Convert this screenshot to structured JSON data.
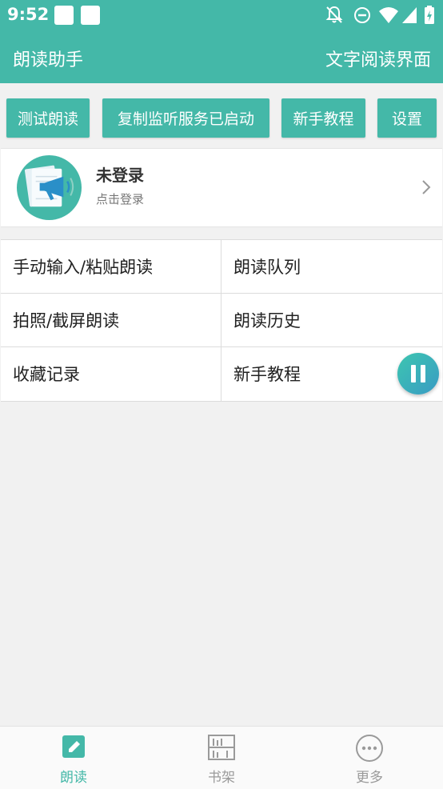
{
  "status_bar": {
    "time": "9:52",
    "icons": [
      "notification-square-icon",
      "notification-square-icon",
      "bell-off-icon",
      "do-not-disturb-icon",
      "wifi-icon",
      "signal-icon",
      "battery-charging-icon"
    ]
  },
  "app_bar": {
    "title": "朗读助手",
    "action": "文字阅读界面"
  },
  "buttons": {
    "test_read": "测试朗读",
    "copy_service": "复制监听服务已启动",
    "tutorial": "新手教程",
    "settings": "设置"
  },
  "login": {
    "name": "未登录",
    "hint": "点击登录",
    "avatar_icon": "megaphone-icon"
  },
  "menu": {
    "manual_input": "手动输入/粘贴朗读",
    "queue": "朗读队列",
    "photo": "拍照/截屏朗读",
    "history": "朗读历史",
    "favorites": "收藏记录",
    "tutorial": "新手教程"
  },
  "bottom_nav": {
    "read": "朗读",
    "bookshelf": "书架",
    "more": "更多"
  },
  "colors": {
    "primary": "#44b8a8",
    "nav_inactive": "#9a9a9a"
  }
}
